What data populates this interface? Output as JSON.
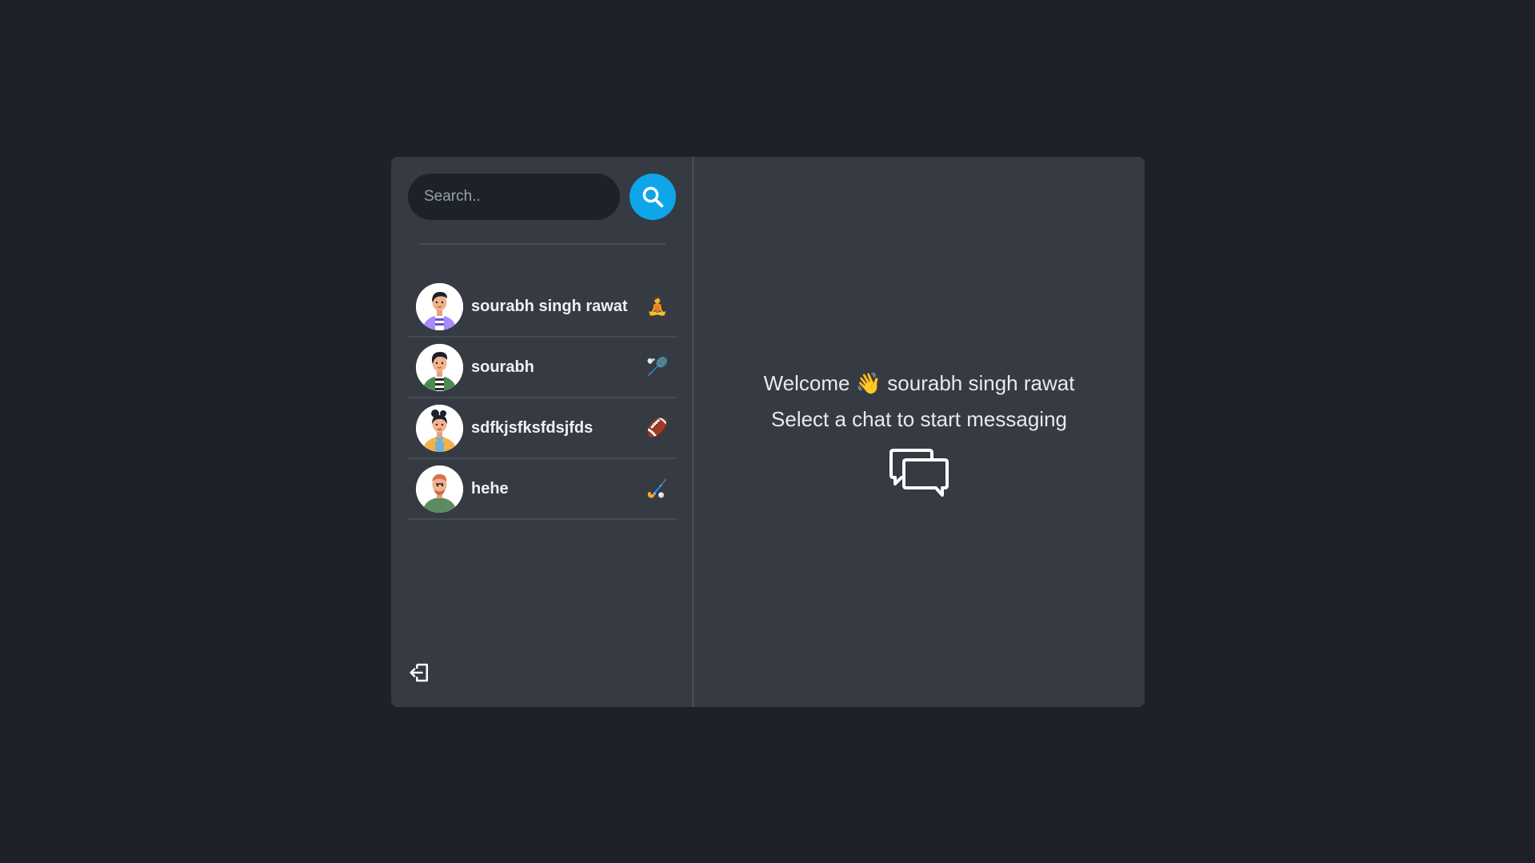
{
  "search": {
    "placeholder": "Search.."
  },
  "conversations": [
    {
      "name": "sourabh singh rawat",
      "emoji": "🧘",
      "avatar_color": "#a78bfa"
    },
    {
      "name": "sourabh",
      "emoji": "🏸",
      "avatar_color": "#4d8b4f"
    },
    {
      "name": "sdfkjsfksfdsjfds",
      "emoji": "🏈",
      "avatar_color": "#f5b04a"
    },
    {
      "name": "hehe",
      "emoji": "🏑",
      "avatar_color": "#5e8a5f"
    }
  ],
  "main": {
    "welcome_prefix": "Welcome",
    "wave_emoji": "👋",
    "user_name": "sourabh singh rawat",
    "subtitle": "Select a chat to start messaging"
  },
  "colors": {
    "background": "#1d222a",
    "panel": "#353a43",
    "accent": "#0ea5e9"
  },
  "icons": {
    "search": "search-icon",
    "logout": "logout-icon",
    "chat": "chat-bubbles-icon"
  }
}
